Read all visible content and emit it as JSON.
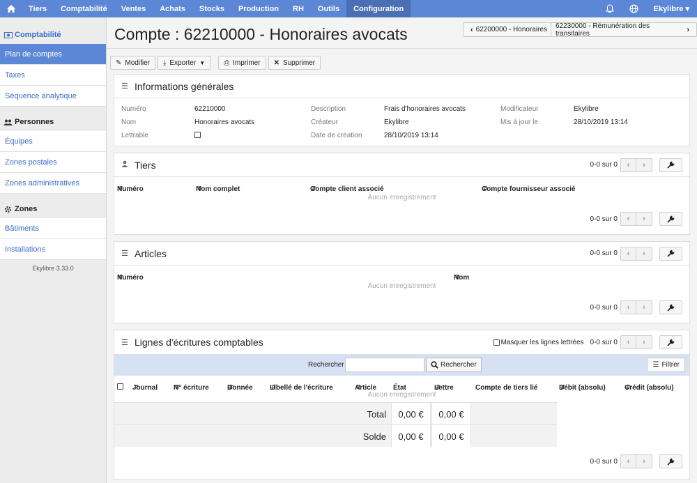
{
  "topnav": {
    "items": [
      "Tiers",
      "Comptabilité",
      "Ventes",
      "Achats",
      "Stocks",
      "Production",
      "RH",
      "Outils",
      "Configuration"
    ],
    "active": "Configuration",
    "user": "Ekylibre ▾"
  },
  "sidebar": {
    "sections": [
      {
        "title": "Comptabilité",
        "items": [
          "Plan de comptes",
          "Taxes",
          "Séquence analytique"
        ]
      },
      {
        "title": "Personnes",
        "items": [
          "Équipes",
          "Zones postales",
          "Zones administratives"
        ]
      },
      {
        "title": "Zones",
        "items": [
          "Bâtiments",
          "Installations"
        ]
      }
    ],
    "active_item": "Plan de comptes",
    "version": "Ekylibre 3.33.0"
  },
  "page": {
    "title": "Compte : 62210000 - Honoraires avocats",
    "prev_account": "62200000 - Honoraires",
    "next_account": "62230000 - Rémunération des transitaires"
  },
  "toolbar": {
    "modify": "Modifier",
    "export": "Exporter",
    "print": "Imprimer",
    "delete": "Supprimer"
  },
  "general": {
    "title": "Informations générales",
    "fields": {
      "numero_label": "Numéro",
      "numero_value": "62210000",
      "nom_label": "Nom",
      "nom_value": "Honoraires avocats",
      "lettrable_label": "Lettrable",
      "description_label": "Description",
      "description_value": "Frais d'honoraires avocats",
      "createur_label": "Créateur",
      "createur_value": "Ekylibre",
      "date_label": "Date de création",
      "date_value": "28/10/2019 13:14",
      "modificateur_label": "Modificateur",
      "modificateur_value": "Ekylibre",
      "maj_label": "Mis à jour le",
      "maj_value": "28/10/2019 13:14"
    }
  },
  "tiers": {
    "title": "Tiers",
    "count": "0-0 sur 0",
    "columns": [
      "Numéro",
      "Nom complet",
      "Compte client associé",
      "Compte fournisseur associé"
    ],
    "empty": "Aucun enregistrement"
  },
  "articles": {
    "title": "Articles",
    "count": "0-0 sur 0",
    "columns": [
      "Numéro",
      "Nom"
    ],
    "empty": "Aucun enregistrement"
  },
  "lines": {
    "title": "Lignes d'écritures comptables",
    "hide_lettered": "Masquer les lignes lettrées",
    "count": "0-0 sur 0",
    "search_label": "Rechercher",
    "search_button": "Rechercher",
    "filter_button": "Filtrer",
    "columns": [
      "Journal",
      "N° écriture",
      "Donnée",
      "Libellé de l'écriture",
      "Article",
      "État",
      "Lettre",
      "Compte de tiers lié",
      "Débit (absolu)",
      "Crédit (absolu)"
    ],
    "empty": "Aucun enregistrement",
    "total_label": "Total",
    "total_debit": "0,00 €",
    "total_credit": "0,00 €",
    "solde_label": "Solde",
    "solde_debit": "0,00 €",
    "solde_credit": "0,00 €"
  }
}
